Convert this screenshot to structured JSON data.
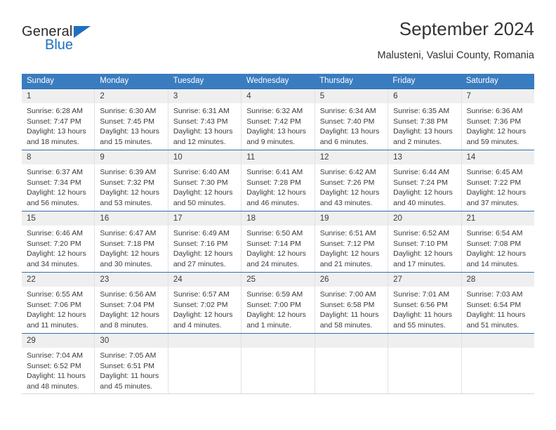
{
  "brand": {
    "name_part1": "General",
    "name_part2": "Blue",
    "accent_color": "#1f70c1"
  },
  "header": {
    "title": "September 2024",
    "subtitle": "Malusteni, Vaslui County, Romania"
  },
  "calendar": {
    "header_color": "#3a7cc0",
    "weekdays": [
      "Sunday",
      "Monday",
      "Tuesday",
      "Wednesday",
      "Thursday",
      "Friday",
      "Saturday"
    ],
    "weeks": [
      [
        {
          "day": "1",
          "sunrise": "Sunrise: 6:28 AM",
          "sunset": "Sunset: 7:47 PM",
          "daylight1": "Daylight: 13 hours",
          "daylight2": "and 18 minutes."
        },
        {
          "day": "2",
          "sunrise": "Sunrise: 6:30 AM",
          "sunset": "Sunset: 7:45 PM",
          "daylight1": "Daylight: 13 hours",
          "daylight2": "and 15 minutes."
        },
        {
          "day": "3",
          "sunrise": "Sunrise: 6:31 AM",
          "sunset": "Sunset: 7:43 PM",
          "daylight1": "Daylight: 13 hours",
          "daylight2": "and 12 minutes."
        },
        {
          "day": "4",
          "sunrise": "Sunrise: 6:32 AM",
          "sunset": "Sunset: 7:42 PM",
          "daylight1": "Daylight: 13 hours",
          "daylight2": "and 9 minutes."
        },
        {
          "day": "5",
          "sunrise": "Sunrise: 6:34 AM",
          "sunset": "Sunset: 7:40 PM",
          "daylight1": "Daylight: 13 hours",
          "daylight2": "and 6 minutes."
        },
        {
          "day": "6",
          "sunrise": "Sunrise: 6:35 AM",
          "sunset": "Sunset: 7:38 PM",
          "daylight1": "Daylight: 13 hours",
          "daylight2": "and 2 minutes."
        },
        {
          "day": "7",
          "sunrise": "Sunrise: 6:36 AM",
          "sunset": "Sunset: 7:36 PM",
          "daylight1": "Daylight: 12 hours",
          "daylight2": "and 59 minutes."
        }
      ],
      [
        {
          "day": "8",
          "sunrise": "Sunrise: 6:37 AM",
          "sunset": "Sunset: 7:34 PM",
          "daylight1": "Daylight: 12 hours",
          "daylight2": "and 56 minutes."
        },
        {
          "day": "9",
          "sunrise": "Sunrise: 6:39 AM",
          "sunset": "Sunset: 7:32 PM",
          "daylight1": "Daylight: 12 hours",
          "daylight2": "and 53 minutes."
        },
        {
          "day": "10",
          "sunrise": "Sunrise: 6:40 AM",
          "sunset": "Sunset: 7:30 PM",
          "daylight1": "Daylight: 12 hours",
          "daylight2": "and 50 minutes."
        },
        {
          "day": "11",
          "sunrise": "Sunrise: 6:41 AM",
          "sunset": "Sunset: 7:28 PM",
          "daylight1": "Daylight: 12 hours",
          "daylight2": "and 46 minutes."
        },
        {
          "day": "12",
          "sunrise": "Sunrise: 6:42 AM",
          "sunset": "Sunset: 7:26 PM",
          "daylight1": "Daylight: 12 hours",
          "daylight2": "and 43 minutes."
        },
        {
          "day": "13",
          "sunrise": "Sunrise: 6:44 AM",
          "sunset": "Sunset: 7:24 PM",
          "daylight1": "Daylight: 12 hours",
          "daylight2": "and 40 minutes."
        },
        {
          "day": "14",
          "sunrise": "Sunrise: 6:45 AM",
          "sunset": "Sunset: 7:22 PM",
          "daylight1": "Daylight: 12 hours",
          "daylight2": "and 37 minutes."
        }
      ],
      [
        {
          "day": "15",
          "sunrise": "Sunrise: 6:46 AM",
          "sunset": "Sunset: 7:20 PM",
          "daylight1": "Daylight: 12 hours",
          "daylight2": "and 34 minutes."
        },
        {
          "day": "16",
          "sunrise": "Sunrise: 6:47 AM",
          "sunset": "Sunset: 7:18 PM",
          "daylight1": "Daylight: 12 hours",
          "daylight2": "and 30 minutes."
        },
        {
          "day": "17",
          "sunrise": "Sunrise: 6:49 AM",
          "sunset": "Sunset: 7:16 PM",
          "daylight1": "Daylight: 12 hours",
          "daylight2": "and 27 minutes."
        },
        {
          "day": "18",
          "sunrise": "Sunrise: 6:50 AM",
          "sunset": "Sunset: 7:14 PM",
          "daylight1": "Daylight: 12 hours",
          "daylight2": "and 24 minutes."
        },
        {
          "day": "19",
          "sunrise": "Sunrise: 6:51 AM",
          "sunset": "Sunset: 7:12 PM",
          "daylight1": "Daylight: 12 hours",
          "daylight2": "and 21 minutes."
        },
        {
          "day": "20",
          "sunrise": "Sunrise: 6:52 AM",
          "sunset": "Sunset: 7:10 PM",
          "daylight1": "Daylight: 12 hours",
          "daylight2": "and 17 minutes."
        },
        {
          "day": "21",
          "sunrise": "Sunrise: 6:54 AM",
          "sunset": "Sunset: 7:08 PM",
          "daylight1": "Daylight: 12 hours",
          "daylight2": "and 14 minutes."
        }
      ],
      [
        {
          "day": "22",
          "sunrise": "Sunrise: 6:55 AM",
          "sunset": "Sunset: 7:06 PM",
          "daylight1": "Daylight: 12 hours",
          "daylight2": "and 11 minutes."
        },
        {
          "day": "23",
          "sunrise": "Sunrise: 6:56 AM",
          "sunset": "Sunset: 7:04 PM",
          "daylight1": "Daylight: 12 hours",
          "daylight2": "and 8 minutes."
        },
        {
          "day": "24",
          "sunrise": "Sunrise: 6:57 AM",
          "sunset": "Sunset: 7:02 PM",
          "daylight1": "Daylight: 12 hours",
          "daylight2": "and 4 minutes."
        },
        {
          "day": "25",
          "sunrise": "Sunrise: 6:59 AM",
          "sunset": "Sunset: 7:00 PM",
          "daylight1": "Daylight: 12 hours",
          "daylight2": "and 1 minute."
        },
        {
          "day": "26",
          "sunrise": "Sunrise: 7:00 AM",
          "sunset": "Sunset: 6:58 PM",
          "daylight1": "Daylight: 11 hours",
          "daylight2": "and 58 minutes."
        },
        {
          "day": "27",
          "sunrise": "Sunrise: 7:01 AM",
          "sunset": "Sunset: 6:56 PM",
          "daylight1": "Daylight: 11 hours",
          "daylight2": "and 55 minutes."
        },
        {
          "day": "28",
          "sunrise": "Sunrise: 7:03 AM",
          "sunset": "Sunset: 6:54 PM",
          "daylight1": "Daylight: 11 hours",
          "daylight2": "and 51 minutes."
        }
      ],
      [
        {
          "day": "29",
          "sunrise": "Sunrise: 7:04 AM",
          "sunset": "Sunset: 6:52 PM",
          "daylight1": "Daylight: 11 hours",
          "daylight2": "and 48 minutes."
        },
        {
          "day": "30",
          "sunrise": "Sunrise: 7:05 AM",
          "sunset": "Sunset: 6:51 PM",
          "daylight1": "Daylight: 11 hours",
          "daylight2": "and 45 minutes."
        },
        {
          "day": "",
          "sunrise": "",
          "sunset": "",
          "daylight1": "",
          "daylight2": ""
        },
        {
          "day": "",
          "sunrise": "",
          "sunset": "",
          "daylight1": "",
          "daylight2": ""
        },
        {
          "day": "",
          "sunrise": "",
          "sunset": "",
          "daylight1": "",
          "daylight2": ""
        },
        {
          "day": "",
          "sunrise": "",
          "sunset": "",
          "daylight1": "",
          "daylight2": ""
        },
        {
          "day": "",
          "sunrise": "",
          "sunset": "",
          "daylight1": "",
          "daylight2": ""
        }
      ]
    ]
  }
}
